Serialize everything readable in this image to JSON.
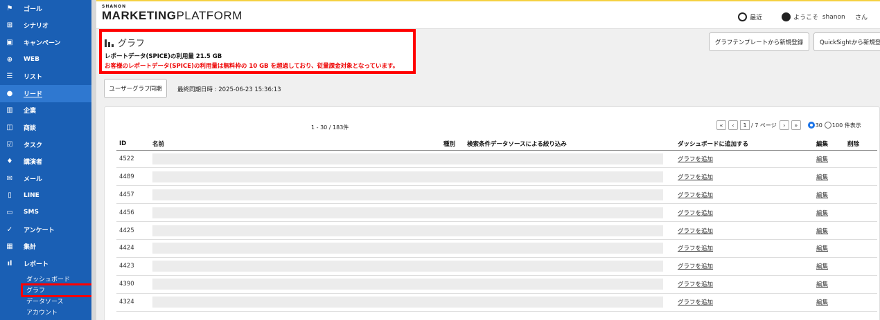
{
  "sidebar": {
    "items": [
      {
        "label": "ゴール",
        "icon": "flag-icon",
        "glyph": "⚑"
      },
      {
        "label": "シナリオ",
        "icon": "scenario-icon",
        "glyph": "⊞"
      },
      {
        "label": "キャンペーン",
        "icon": "calendar-icon",
        "glyph": "▣"
      },
      {
        "label": "WEB",
        "icon": "globe-icon",
        "glyph": "⊕"
      },
      {
        "label": "リスト",
        "icon": "list-icon",
        "glyph": "☰"
      },
      {
        "label": "リード",
        "icon": "person-icon",
        "glyph": "●"
      },
      {
        "label": "企業",
        "icon": "building-icon",
        "glyph": "▥"
      },
      {
        "label": "商談",
        "icon": "briefcase-icon",
        "glyph": "◫"
      },
      {
        "label": "タスク",
        "icon": "task-icon",
        "glyph": "☑"
      },
      {
        "label": "講演者",
        "icon": "mic-icon",
        "glyph": "♦"
      },
      {
        "label": "メール",
        "icon": "mail-icon",
        "glyph": "✉"
      },
      {
        "label": "LINE",
        "icon": "line-icon",
        "glyph": "▯"
      },
      {
        "label": "SMS",
        "icon": "sms-icon",
        "glyph": "▭"
      },
      {
        "label": "アンケート",
        "icon": "check-icon",
        "glyph": "✓"
      },
      {
        "label": "集計",
        "icon": "tally-icon",
        "glyph": "▦"
      },
      {
        "label": "レポート",
        "icon": "report-icon",
        "glyph": "ıl"
      }
    ],
    "sub_items": [
      "ダッシュボード",
      "グラフ",
      "データソース",
      "アカウント"
    ]
  },
  "header": {
    "logo_small": "SHANON",
    "logo_bold": "MARKETING",
    "logo_light": "PLATFORM",
    "recent": "最近",
    "welcome": "ようこそ",
    "user": "shanon",
    "honorific": "さん"
  },
  "page": {
    "title": "グラフ",
    "usage": "レポートデータ(SPICE)の利用量 21.5 GB",
    "warning": "お客様のレポートデータ(SPICE)の利用量は無料枠の 10 GB を超過しており、従量課金対象となっています。",
    "btn_template": "グラフテンプレートから新規登録",
    "btn_quicksight": "QuickSightから新規登録",
    "btn_sync": "ユーザーグラフ同期",
    "last_sync": "最終同期日時 : 2025-06-23 15:36:13"
  },
  "table": {
    "count": "1 - 30 / 183件",
    "pager": {
      "first": "«",
      "prev": "‹",
      "page": "1",
      "of": "/ 7 ページ",
      "next": "›",
      "last": "»",
      "opt30": "30",
      "opt100": "100 件表示"
    },
    "headers": {
      "id": "ID",
      "name": "名前",
      "type": "種別",
      "filter": "検索条件データソースによる絞り込み",
      "dashboard": "ダッシュボードに追加する",
      "edit": "編集",
      "delete": "削除"
    },
    "rows": [
      {
        "id": "4522",
        "add": "グラフを追加",
        "edit": "編集"
      },
      {
        "id": "4489",
        "add": "グラフを追加",
        "edit": "編集"
      },
      {
        "id": "4457",
        "add": "グラフを追加",
        "edit": "編集"
      },
      {
        "id": "4456",
        "add": "グラフを追加",
        "edit": "編集"
      },
      {
        "id": "4425",
        "add": "グラフを追加",
        "edit": "編集"
      },
      {
        "id": "4424",
        "add": "グラフを追加",
        "edit": "編集"
      },
      {
        "id": "4423",
        "add": "グラフを追加",
        "edit": "編集"
      },
      {
        "id": "4390",
        "add": "グラフを追加",
        "edit": "編集"
      },
      {
        "id": "4324",
        "add": "グラフを追加",
        "edit": "編集"
      }
    ]
  }
}
